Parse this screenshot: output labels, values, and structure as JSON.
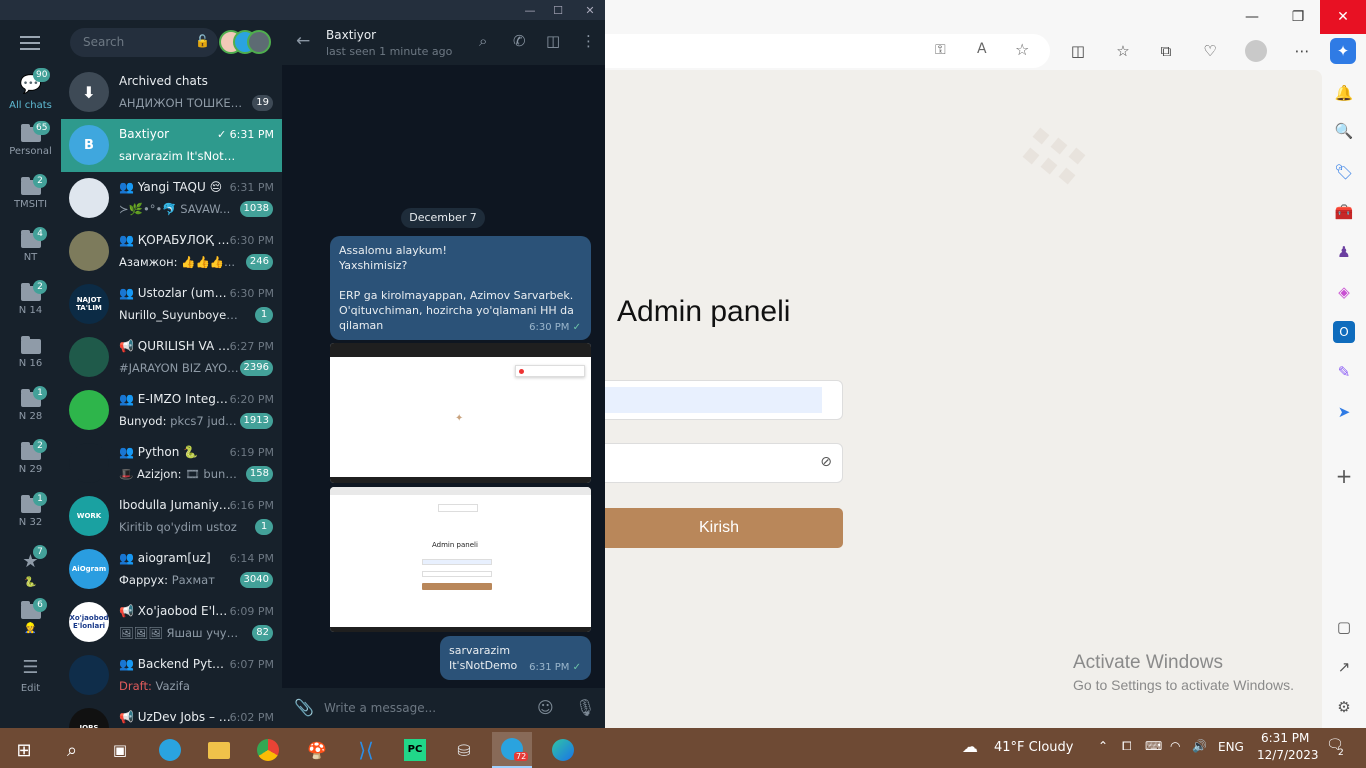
{
  "telegram": {
    "search_placeholder": "Search",
    "folders": [
      {
        "label": "All chats",
        "badge": "90"
      },
      {
        "label": "Personal",
        "badge": "65"
      },
      {
        "label": "TMSITI",
        "badge": "2"
      },
      {
        "label": "NT",
        "badge": "4"
      },
      {
        "label": "N 14",
        "badge": "2"
      },
      {
        "label": "N 16",
        "badge": ""
      },
      {
        "label": "N 28",
        "badge": "1"
      },
      {
        "label": "N 29",
        "badge": "2"
      },
      {
        "label": "N 32",
        "badge": "1"
      },
      {
        "label": "🐍",
        "badge": "7"
      },
      {
        "label": "👷",
        "badge": "6"
      },
      {
        "label": "Edit",
        "badge": ""
      }
    ],
    "chats": [
      {
        "name": "Archived chats",
        "time": "",
        "sender": "",
        "message": "АНДИЖОН ТОШКЕ... 🤍",
        "badge": "19",
        "avatar_text": "",
        "avatar_color": "#3e4a56"
      },
      {
        "name": "Baxtiyor",
        "time": "✓ 6:31 PM",
        "sender": "",
        "message": "sarvarazim It'sNotDemo",
        "badge": "",
        "avatar_text": "B",
        "avatar_color": "#3fa7de"
      },
      {
        "name": "👥 Yangi TAQU 😔",
        "time": "6:31 PM",
        "sender": "",
        "message": "≻🌿•°•🐬 SAVAW...",
        "badge": "1038",
        "avatar_text": "",
        "avatar_color": "#dfe6ee"
      },
      {
        "name": "👥 ҚОРАБУЛОҚ М...",
        "time": "6:30 PM",
        "sender": "Азамжон: ",
        "message": "👍👍👍...",
        "badge": "246",
        "avatar_text": "",
        "avatar_color": "#7d7b5c"
      },
      {
        "name": "👥 Ustozlar (umu...",
        "time": "6:30 PM",
        "sender": "Nurillo_Suyunboyev: ",
        "message": "⬜",
        "badge": "1",
        "avatar_text": "NAJOT TA'LIM",
        "avatar_color": "#0c2b45"
      },
      {
        "name": "📢 QURILISH VA UY...",
        "time": "6:27 PM",
        "sender": "",
        "message": "#JARAYON  BIZ AYOL...",
        "badge": "2396",
        "avatar_text": "",
        "avatar_color": "#1f5a4a"
      },
      {
        "name": "👥 E-IMZO Integrat...",
        "time": "6:20 PM",
        "sender": "Bunyod: ",
        "message": "pkcs7 juda ...",
        "badge": "1913",
        "avatar_text": "",
        "avatar_color": "#2eb54b"
      },
      {
        "name": "👥 Python 🐍",
        "time": "6:19 PM",
        "sender": "🎩 Azizjon: ",
        "message": "🎞 buna...",
        "badge": "158",
        "avatar_text": "",
        "avatar_color": "#17212b"
      },
      {
        "name": "Ibodulla Jumaniyoz...",
        "time": "6:16 PM",
        "sender": "",
        "message": "Kiritib qo'ydim ustoz",
        "badge": "1",
        "avatar_text": "WORK",
        "avatar_color": "#1aa1a1"
      },
      {
        "name": "👥 aiogram[uz]",
        "time": "6:14 PM",
        "sender": "Фаррух: ",
        "message": "Рахмат",
        "badge": "3040",
        "avatar_text": "AiOgram",
        "avatar_color": "#2a9de0"
      },
      {
        "name": "📢 Xo'jaobod E'lon...",
        "time": "6:09 PM",
        "sender": "",
        "message": "🖼🖼🖼 Яшаш учун т...",
        "badge": "82",
        "avatar_text": "Xo'jaobod E'lonlari",
        "avatar_color": "#ffffff"
      },
      {
        "name": "👥 Backend Pytho...",
        "time": "6:07 PM",
        "sender": "Draft: ",
        "message": "Vazifa",
        "badge": "",
        "avatar_text": "",
        "avatar_color": "#0f2d4a"
      },
      {
        "name": "📢 UzDev Jobs – IT J...",
        "time": "6:02 PM",
        "sender": "",
        "message": "",
        "badge": "",
        "avatar_text": "JOBS",
        "avatar_color": "#111111"
      }
    ],
    "conversation": {
      "name": "Baxtiyor",
      "status": "last seen 1 minute ago",
      "date": "December 7",
      "message1": "Assalomu alaykum!\nYaxshimisiz?\n\nERP ga kirolmayappan, Azimov Sarvarbek. O'qituvchiman, hozircha yo'qlamani HH da qilaman",
      "message1_time": "6:30 PM",
      "screenshot_title": "Admin paneli",
      "message2": "sarvarazim\nIt'sNotDemo",
      "message2_time": "6:31 PM",
      "compose_placeholder": "Write a message..."
    }
  },
  "browser": {
    "page_title": "Admin paneli",
    "login_button": "Kirish",
    "watermark_line1": "Activate Windows",
    "watermark_line2": "Go to Settings to activate Windows."
  },
  "taskbar": {
    "weather": "41°F  Cloudy",
    "lang": "ENG",
    "time": "6:31 PM",
    "date": "12/7/2023",
    "telegram_badge": "72",
    "notif_count": "2"
  }
}
